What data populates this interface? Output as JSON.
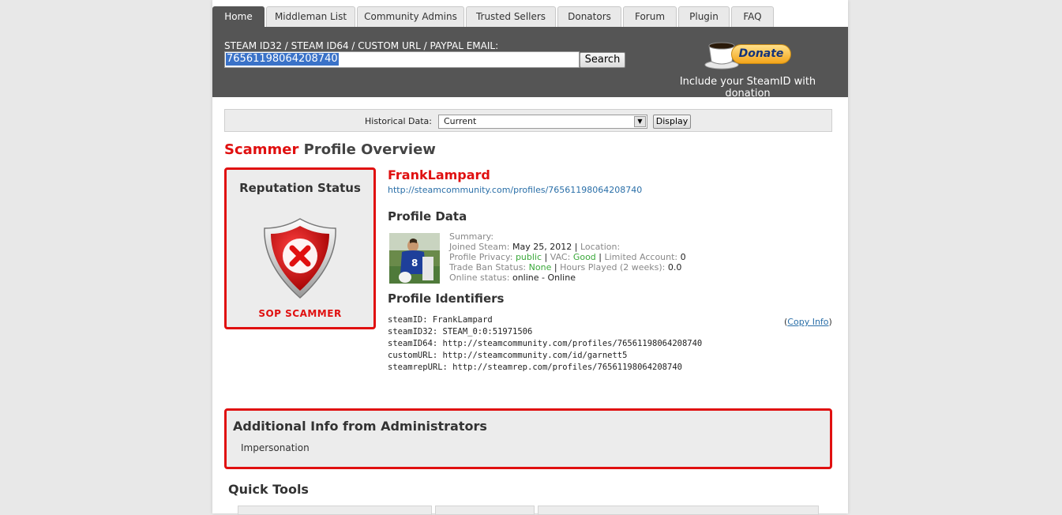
{
  "nav": {
    "tabs": [
      "Home",
      "Middleman List",
      "Community Admins",
      "Trusted Sellers",
      "Donators",
      "Forum",
      "Plugin",
      "FAQ"
    ]
  },
  "search": {
    "label": "STEAM ID32 / STEAM ID64 / CUSTOM URL / PAYPAL EMAIL:",
    "value": "76561198064208740",
    "button": "Search"
  },
  "donate": {
    "button": "Donate",
    "note": "Include your SteamID with donation"
  },
  "historical": {
    "label": "Historical Data:",
    "selected": "Current",
    "button": "Display"
  },
  "overview": {
    "title_red": "Scammer",
    "title_rest": " Profile Overview"
  },
  "reputation": {
    "title": "Reputation Status",
    "status": "SOP SCAMMER"
  },
  "profile": {
    "name": "FrankLampard",
    "url": "http://steamcommunity.com/profiles/76561198064208740",
    "data_heading": "Profile Data",
    "summary_label": "Summary:",
    "joined_label": "Joined Steam:",
    "joined_value": "May 25, 2012",
    "location_label": "Location:",
    "privacy_label": "Profile Privacy:",
    "privacy_value": "public",
    "vac_label": "VAC:",
    "vac_value": "Good",
    "limited_label": "Limited Account:",
    "limited_value": "0",
    "tradeban_label": "Trade Ban Status:",
    "tradeban_value": "None",
    "hours_label": "Hours Played (2 weeks):",
    "hours_value": "0.0",
    "online_label": "Online status:",
    "online_value": "online - Online",
    "sep": "|"
  },
  "identifiers": {
    "heading": "Profile Identifiers",
    "lines": [
      "steamID: FrankLampard",
      "steamID32: STEAM_0:0:51971506",
      "steamID64: http://steamcommunity.com/profiles/76561198064208740",
      "customURL: http://steamcommunity.com/id/garnett5",
      "steamrepURL: http://steamrep.com/profiles/76561198064208740"
    ],
    "copy_open": "(",
    "copy_link": "Copy Info",
    "copy_close": ")"
  },
  "admin": {
    "title": "Additional Info from Administrators",
    "body": "Impersonation"
  },
  "quick_tools": {
    "title": "Quick Tools"
  },
  "colors": {
    "accent_red": "#e01010",
    "header_gray": "#555555",
    "good_green": "#3aa83a",
    "link_blue": "#2a6fa8"
  }
}
